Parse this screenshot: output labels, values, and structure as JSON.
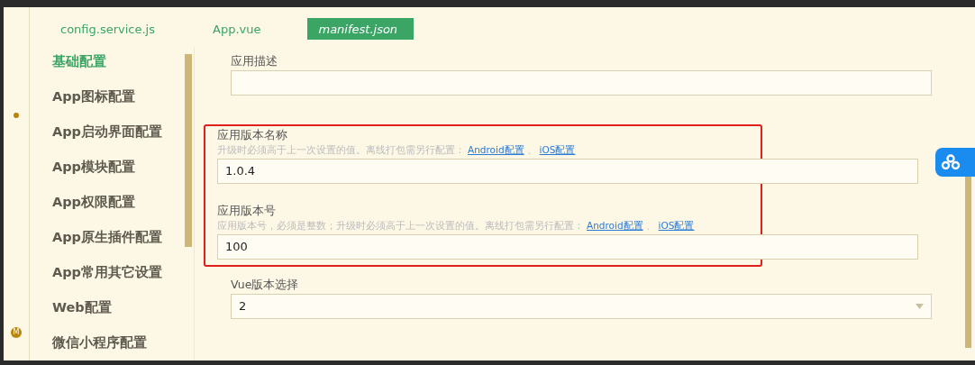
{
  "tabs": [
    {
      "label": "config.service.js",
      "selected": false
    },
    {
      "label": "App.vue",
      "selected": false
    },
    {
      "label": "manifest.json",
      "selected": true
    }
  ],
  "sidebar": {
    "items": [
      {
        "label": "基础配置",
        "selected": true
      },
      {
        "label": "App图标配置",
        "selected": false
      },
      {
        "label": "App启动界面配置",
        "selected": false
      },
      {
        "label": "App模块配置",
        "selected": false
      },
      {
        "label": "App权限配置",
        "selected": false
      },
      {
        "label": "App原生插件配置",
        "selected": false
      },
      {
        "label": "App常用其它设置",
        "selected": false
      },
      {
        "label": "Web配置",
        "selected": false
      },
      {
        "label": "微信小程序配置",
        "selected": false
      }
    ]
  },
  "left_badge": "M",
  "sections": [
    {
      "highlighted": false,
      "fields": [
        {
          "kind": "text",
          "label": "应用描述"
        }
      ]
    },
    {
      "highlighted": true,
      "fields": [
        {
          "kind": "text",
          "label": "应用版本名称",
          "hint": {
            "text": "升级时必须高于上一次设置的值。离线打包需另行配置：",
            "links": [
              "Android配置",
              "iOS配置"
            ],
            "separator": "、"
          },
          "value": "1.0.4"
        },
        {
          "kind": "text",
          "label": "应用版本号",
          "hint": {
            "text": "应用版本号，必须是整数；升级时必须高于上一次设置的值。离线打包需另行配置：",
            "links": [
              "Android配置",
              "iOS配置"
            ],
            "separator": "、"
          },
          "value": "100"
        }
      ]
    },
    {
      "highlighted": false,
      "fields": [
        {
          "kind": "select",
          "label": "Vue版本选择",
          "value": "2"
        }
      ]
    }
  ]
}
